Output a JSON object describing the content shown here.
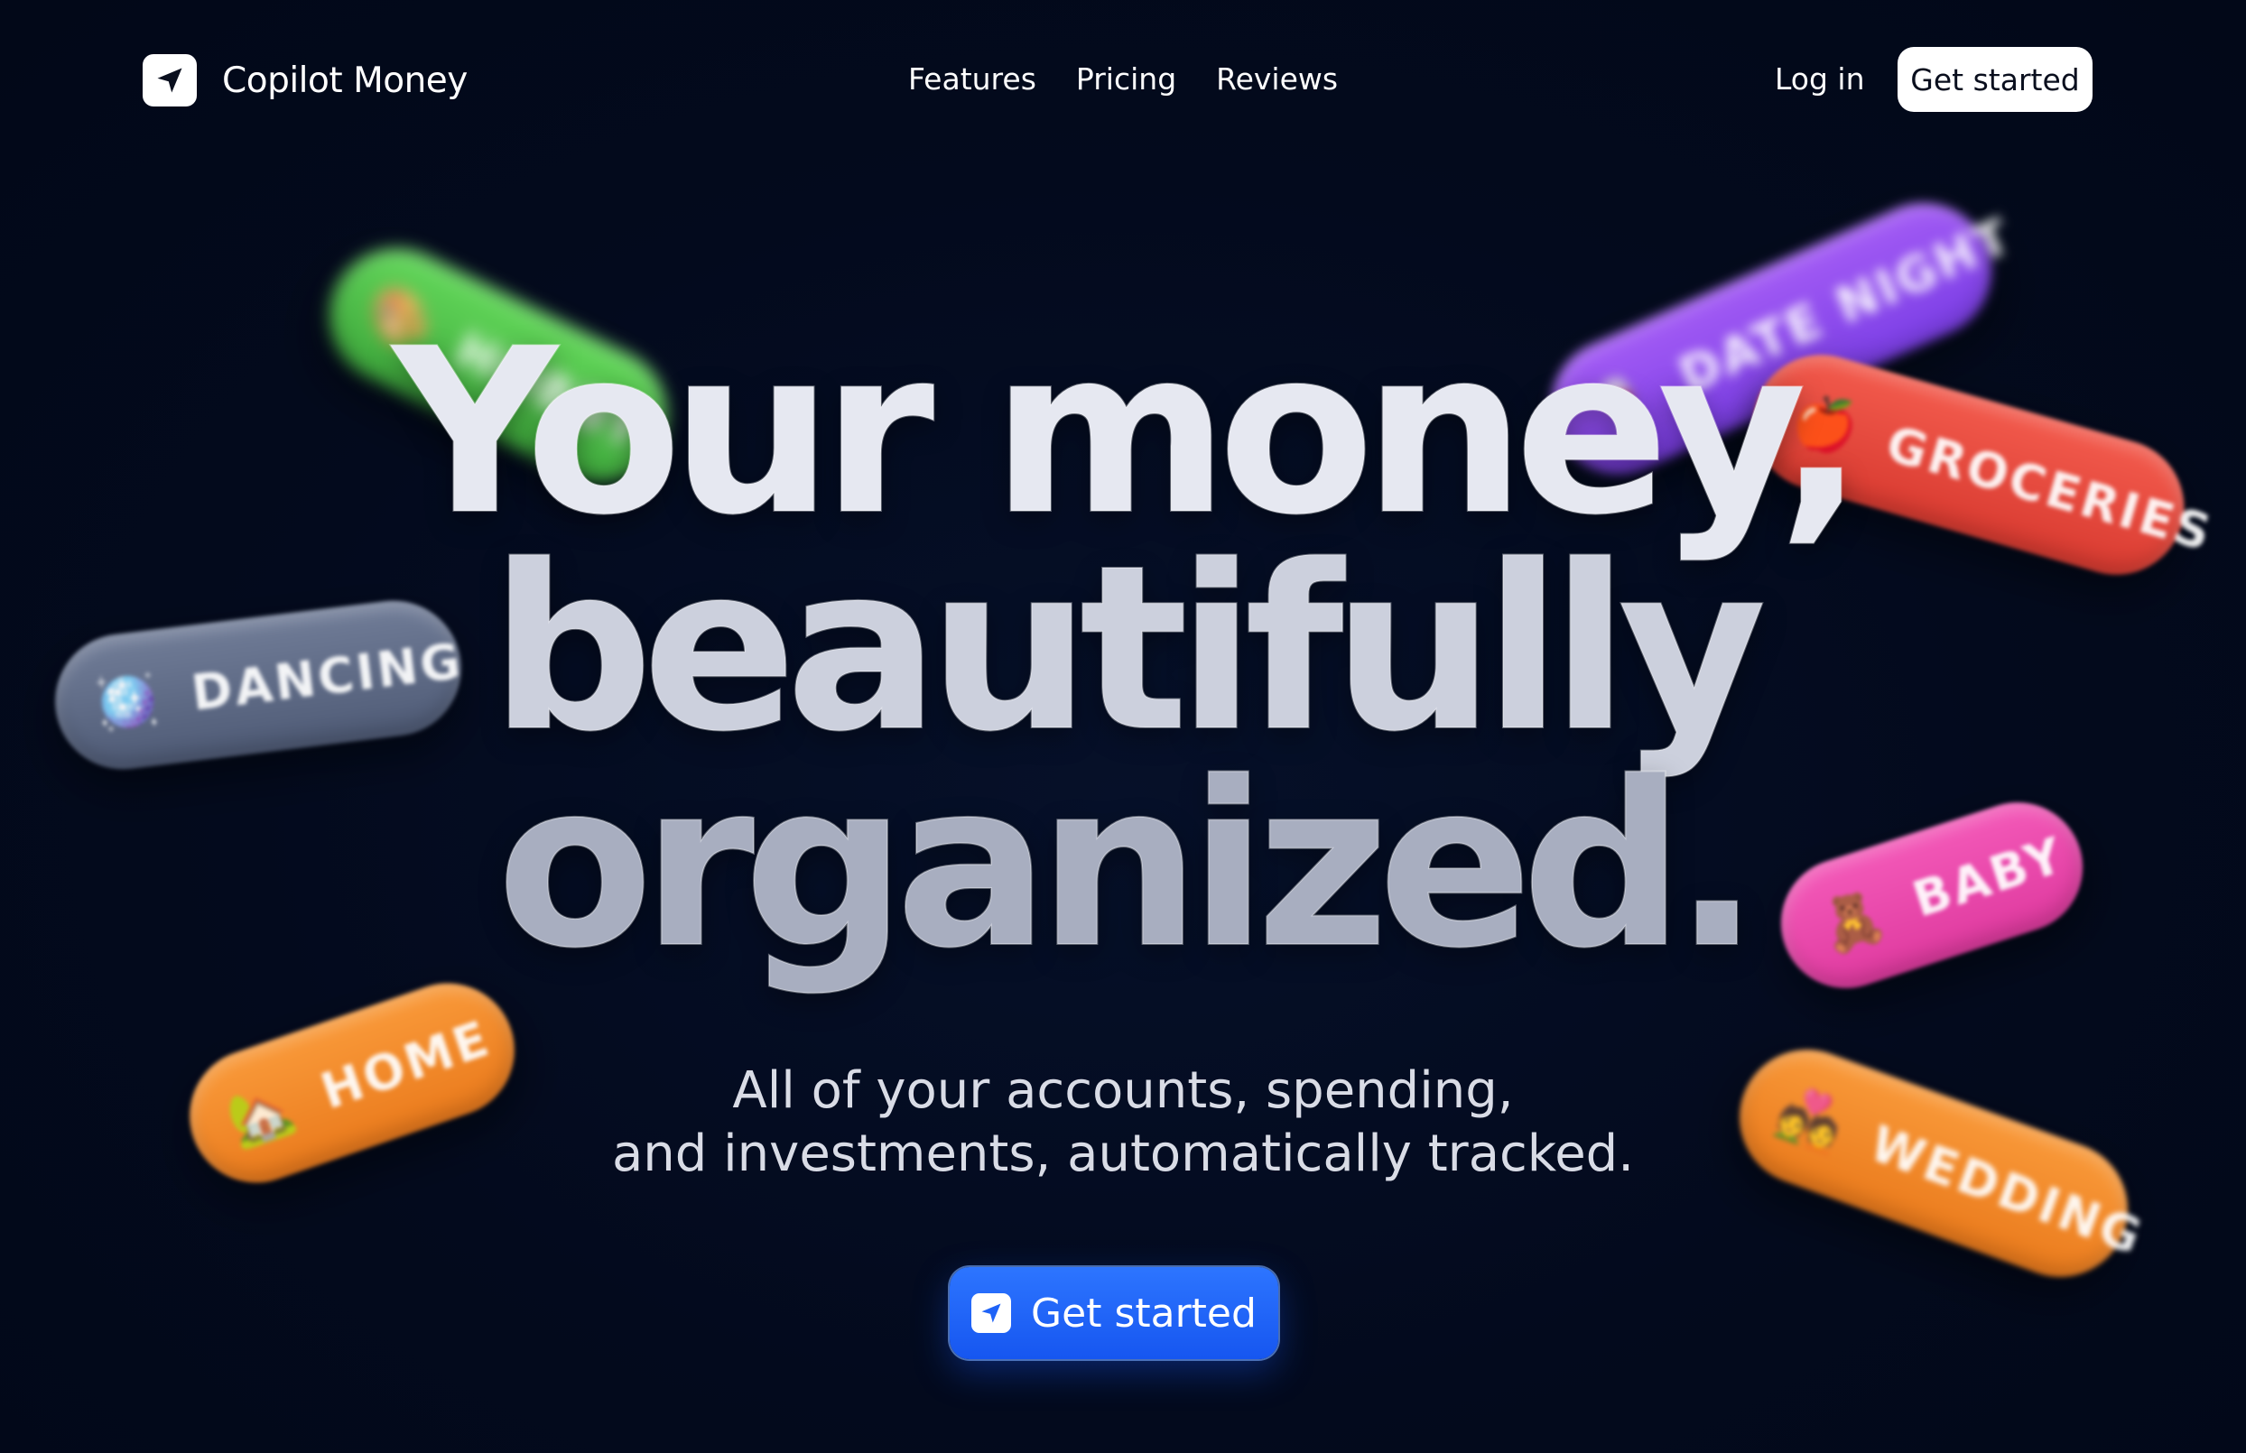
{
  "nav": {
    "brand": "Copilot Money",
    "links": [
      "Features",
      "Pricing",
      "Reviews"
    ],
    "login": "Log in",
    "cta": "Get started"
  },
  "hero": {
    "line1": "Your money,",
    "line2": "beautifully",
    "line3": "organized.",
    "sub_line1": "All of your accounts, spending,",
    "sub_line2": "and investments, automatically tracked.",
    "cta": "Get started"
  },
  "tags": {
    "hobby": {
      "label": "HOBBY",
      "icon": "🎨",
      "color": "#4cc446"
    },
    "date_night": {
      "label": "DATE NIGHT",
      "icon": "🍷",
      "color": "#8f4bf0"
    },
    "groceries": {
      "label": "GROCERIES",
      "icon": "🍎",
      "color": "#e94a3d"
    },
    "dancing": {
      "label": "DANCING",
      "icon": "🪩",
      "color": "#626e89"
    },
    "baby": {
      "label": "BABY",
      "icon": "🧸",
      "color": "#ea4aad"
    },
    "home": {
      "label": "HOME",
      "icon": "🏡",
      "color": "#f28a2a"
    },
    "wedding": {
      "label": "WEDDING",
      "icon": "💑",
      "color": "#f28a2a"
    }
  },
  "colors": {
    "background": "#030b1f",
    "cta_blue": "#1f63f7"
  }
}
